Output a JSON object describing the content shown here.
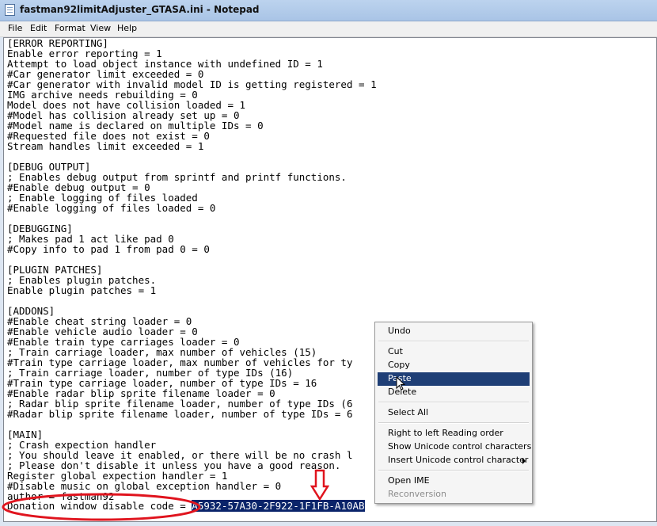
{
  "window": {
    "title": "fastman92limitAdjuster_GTASA.ini - Notepad"
  },
  "menubar": {
    "items": [
      "File",
      "Edit",
      "Format",
      "View",
      "Help"
    ]
  },
  "editor": {
    "lines": [
      "[ERROR REPORTING]",
      "Enable error reporting = 1",
      "Attempt to load object instance with undefined ID = 1",
      "#Car generator limit exceeded = 0",
      "#Car generator with invalid model ID is getting registered = 1",
      "IMG archive needs rebuilding = 0",
      "Model does not have collision loaded = 1",
      "#Model has collision already set up = 0",
      "#Model name is declared on multiple IDs = 0",
      "#Requested file does not exist = 0",
      "Stream handles limit exceeded = 1",
      "",
      "[DEBUG OUTPUT]",
      "; Enables debug output from sprintf and printf functions.",
      "#Enable debug output = 0",
      "; Enable logging of files loaded",
      "#Enable logging of files loaded = 0",
      "",
      "[DEBUGGING]",
      "; Makes pad 1 act like pad 0",
      "#Copy info to pad 1 from pad 0 = 0",
      "",
      "[PLUGIN PATCHES]",
      "; Enables plugin patches.",
      "Enable plugin patches = 1",
      "",
      "[ADDONS]",
      "#Enable cheat string loader = 0",
      "#Enable vehicle audio loader = 0",
      "#Enable train type carriages loader = 0",
      "; Train carriage loader, max number of vehicles (15)",
      "#Train type carriage loader, max number of vehicles for ty",
      "; Train carriage loader, number of type IDs (16)",
      "#Train type carriage loader, number of type IDs = 16",
      "#Enable radar blip sprite filename loader = 0",
      "; Radar blip sprite filename loader, number of type IDs (6",
      "#Radar blip sprite filename loader, number of type IDs = 6",
      "",
      "[MAIN]",
      "; Crash expection handler",
      "; You should leave it enabled, or there will be no crash l",
      "; Please don't disable it unless you have a good reason.",
      "Register global expection handler = 1",
      "#Disable music on global exception handler = 0",
      "author = fastman92"
    ],
    "last_line_prefix": "Donation window disable code = ",
    "selected_code": "A5932-57A30-2F922-1F1FB-A10AB"
  },
  "context_menu": {
    "undo": "Undo",
    "cut": "Cut",
    "copy": "Copy",
    "paste": "Paste",
    "delete": "Delete",
    "select_all": "Select All",
    "rtl": "Right to left Reading order",
    "show_unicode": "Show Unicode control characters",
    "insert_unicode": "Insert Unicode control character",
    "open_ime": "Open IME",
    "reconversion": "Reconversion",
    "highlighted": "Paste"
  },
  "annotation_color": "#e0141e"
}
